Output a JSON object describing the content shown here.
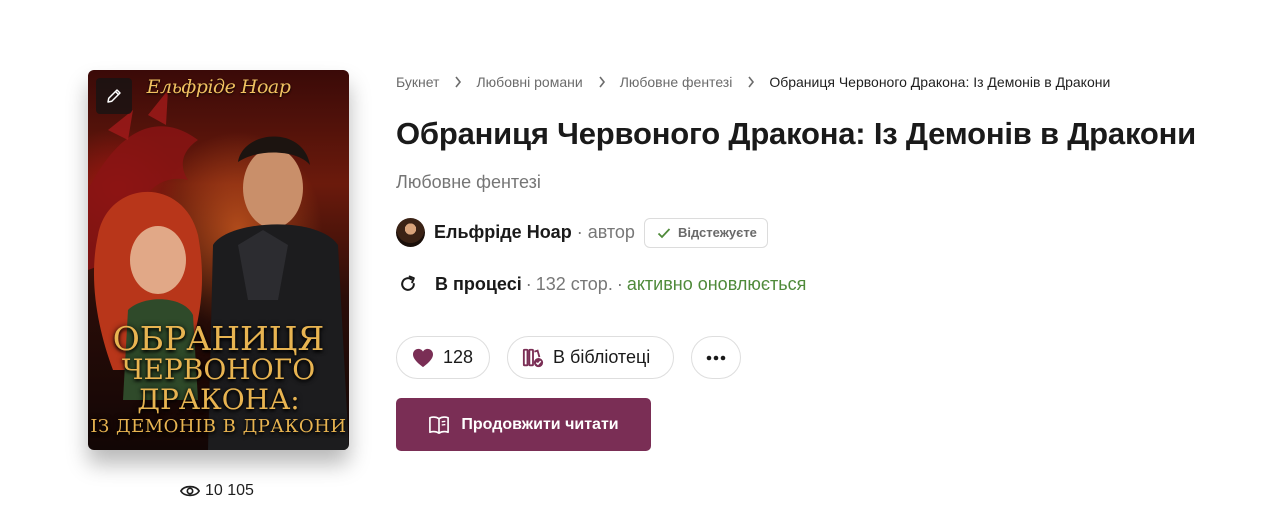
{
  "cover": {
    "author_text": "Ельфріде Ноар",
    "title_line1": "ОБРАНИЦЯ",
    "title_line2": "ЧЕРВОНОГО",
    "title_line3": "ДРАКОНА:",
    "title_line4": "ІЗ ДЕМОНІВ В ДРАКОНИ"
  },
  "views": {
    "count": "10 105",
    "icon": "eye-icon"
  },
  "breadcrumb": {
    "items": [
      "Букнет",
      "Любовні романи",
      "Любовне фентезі"
    ],
    "current": "Обраниця Червоного Дракона: Із Демонів в Дракони"
  },
  "book": {
    "title": "Обраниця Червоного Дракона: Із Демонів в Дракони",
    "genre": "Любовне фентезі"
  },
  "author": {
    "name": "Ельфріде Ноар",
    "role": "· автор",
    "follow_label": "Відстежуєте"
  },
  "status": {
    "state": "В процесі",
    "dot1": "·",
    "pages": "132 стор.",
    "dot2": "·",
    "activity": "активно оновлюється"
  },
  "actions": {
    "likes_count": "128",
    "library_label": "В бібліотеці",
    "read_label": "Продовжити читати"
  },
  "colors": {
    "accent": "#7a2e55",
    "heart": "#7a2e55",
    "active_status": "#4f8a3a"
  }
}
